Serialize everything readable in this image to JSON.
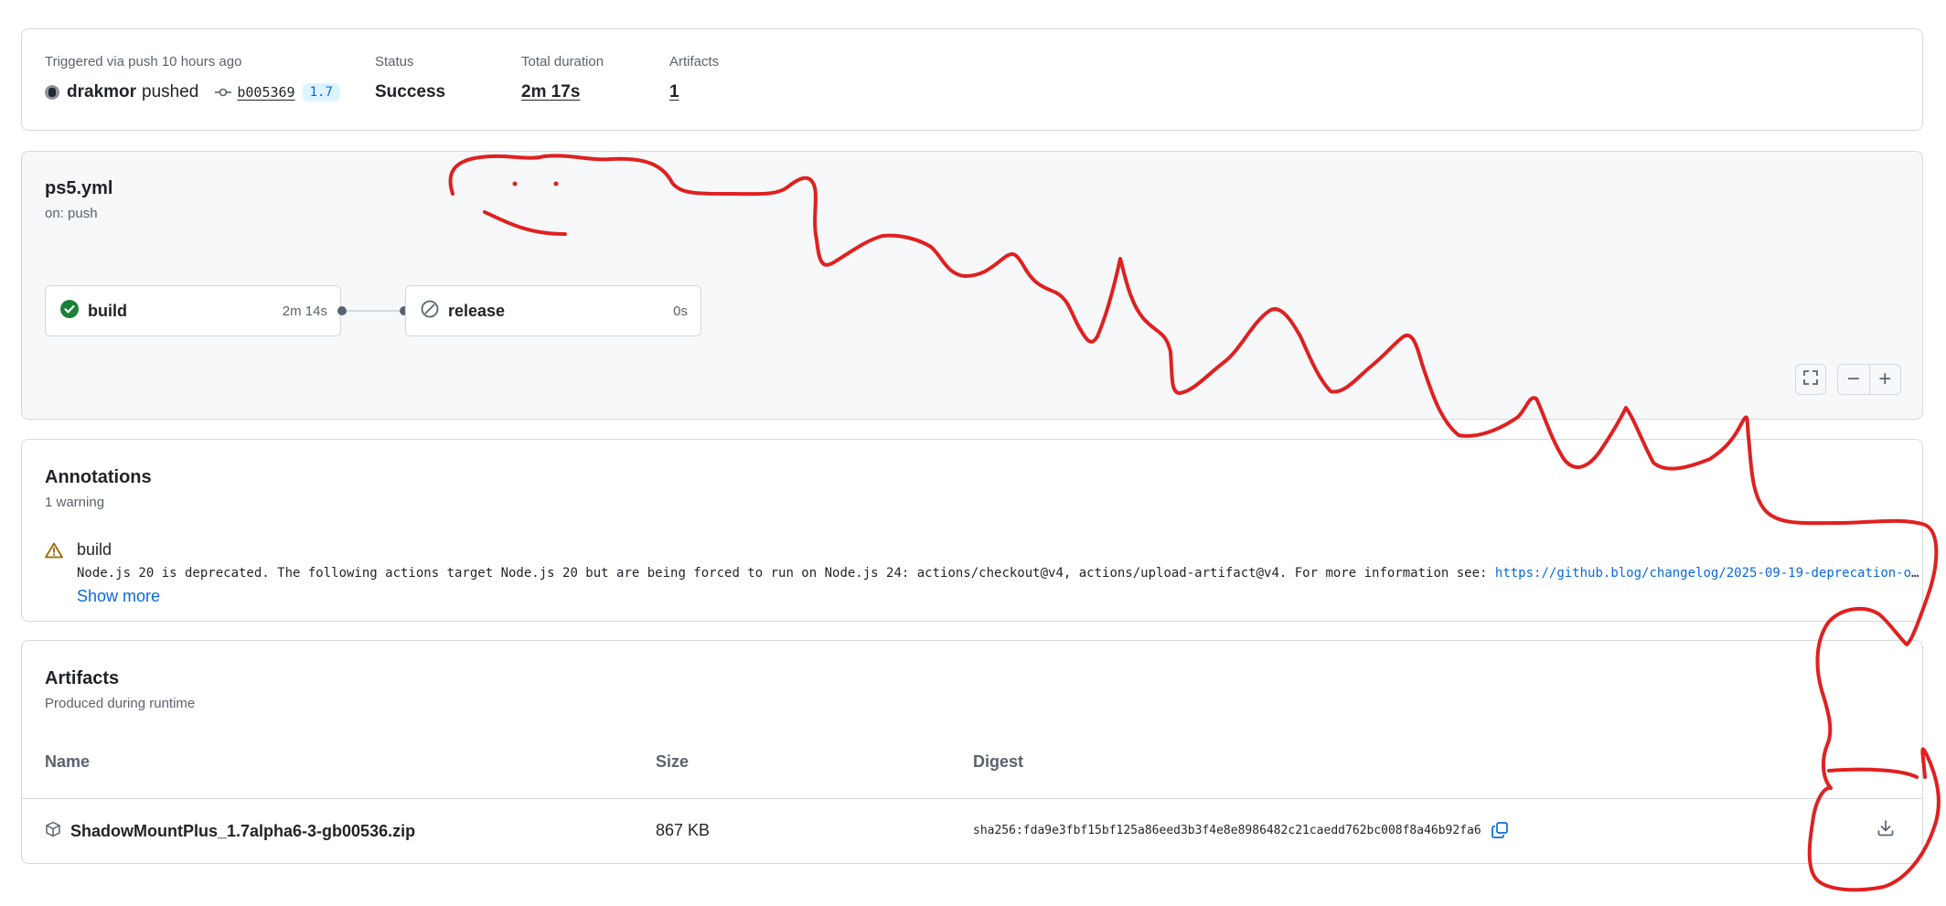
{
  "summary": {
    "trigger_label": "Triggered via push 10 hours ago",
    "actor": "drakmor",
    "action": "pushed",
    "commit": "b005369",
    "branch": "1.7",
    "status_label": "Status",
    "status_value": "Success",
    "duration_label": "Total duration",
    "duration_value": "2m 17s",
    "artifacts_label": "Artifacts",
    "artifacts_count": "1"
  },
  "workflow": {
    "file": "ps5.yml",
    "trigger": "on: push",
    "jobs": [
      {
        "name": "build",
        "duration": "2m 14s",
        "state": "success",
        "icon": "check-circle-icon"
      },
      {
        "name": "release",
        "duration": "0s",
        "state": "skipped",
        "icon": "skip-icon"
      }
    ],
    "controls": {
      "fullscreen_icon": "fullscreen-icon",
      "zoom_out": "−",
      "zoom_in": "+"
    }
  },
  "annotations": {
    "title": "Annotations",
    "subtitle": "1 warning",
    "items": [
      {
        "icon": "warning-icon",
        "job": "build",
        "message": "Node.js 20 is deprecated. The following actions target Node.js 20 but are being forced to run on Node.js 24: actions/checkout@v4, actions/upload-artifact@v4. For more information see: ",
        "link": "https://github.blog/changelog/2025-09-19-deprecation-of-n…"
      }
    ],
    "show_more": "Show more"
  },
  "artifacts": {
    "title": "Artifacts",
    "subtitle": "Produced during runtime",
    "columns": [
      "Name",
      "Size",
      "Digest"
    ],
    "rows": [
      {
        "name": "ShadowMountPlus_1.7alpha6-3-gb00536.zip",
        "size": "867 KB",
        "digest": "sha256:fda9e3fbf15bf125a86eed3b3f4e8e8986482c21caedd762bc008f8a46b92fa6"
      }
    ]
  },
  "colors": {
    "success": "#1a7f37",
    "link": "#0969da",
    "warning": "#9a6700",
    "scribble": "#e02020"
  }
}
